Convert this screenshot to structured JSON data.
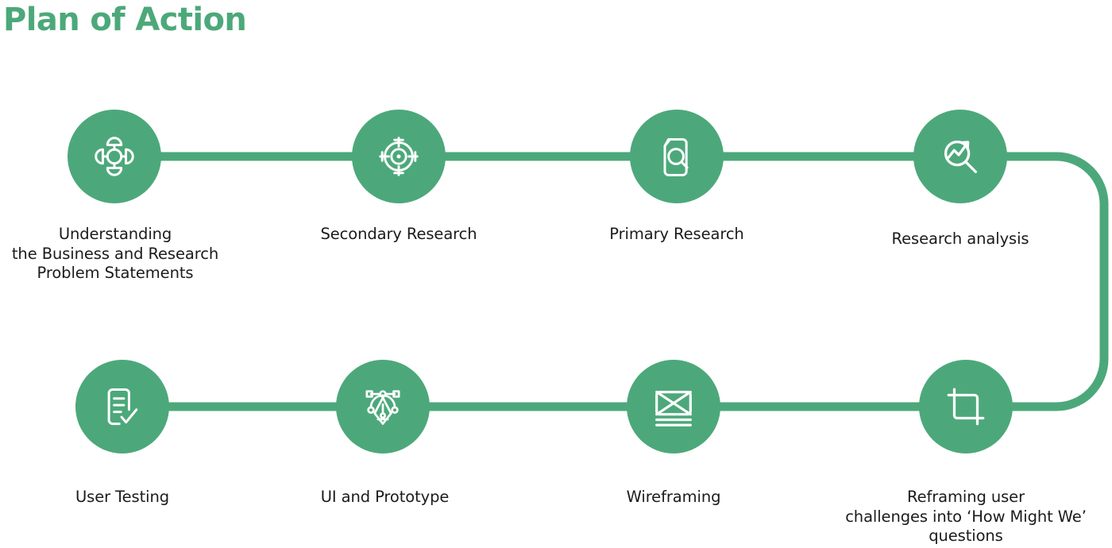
{
  "page": {
    "title": "Plan of Action",
    "background_color": "#ffffff",
    "accent_color": "#4CA87A",
    "label_color": "#1b1b1b"
  },
  "flow": {
    "rows": [
      {
        "name": "top-row",
        "direction": "left-to-right",
        "steps": [
          {
            "index": 1,
            "icon": "network-hub-icon",
            "label": "Understanding\nthe Business and Research\nProblem Statements"
          },
          {
            "index": 2,
            "icon": "target-crosshair-icon",
            "label": "Secondary Research"
          },
          {
            "index": 3,
            "icon": "document-search-icon",
            "label": "Primary Research"
          },
          {
            "index": 4,
            "icon": "trend-analysis-magnifier-icon",
            "label": "Research analysis"
          }
        ]
      },
      {
        "name": "bottom-row",
        "direction": "left-to-right",
        "steps": [
          {
            "index": 8,
            "icon": "document-check-icon",
            "label": "User Testing"
          },
          {
            "index": 7,
            "icon": "pen-tool-icon",
            "label": "UI and Prototype"
          },
          {
            "index": 6,
            "icon": "wireframe-placeholder-icon",
            "label": "Wireframing"
          },
          {
            "index": 5,
            "icon": "crop-tool-icon",
            "label": "Reframing user\nchallenges into ‘How Might We’\nquestions"
          }
        ]
      }
    ],
    "connector": {
      "name": "row-wrap-connector",
      "description": "rounded U turn from end of top row down to end of bottom row",
      "color": "#4CA87A",
      "thickness_px": 11
    }
  }
}
